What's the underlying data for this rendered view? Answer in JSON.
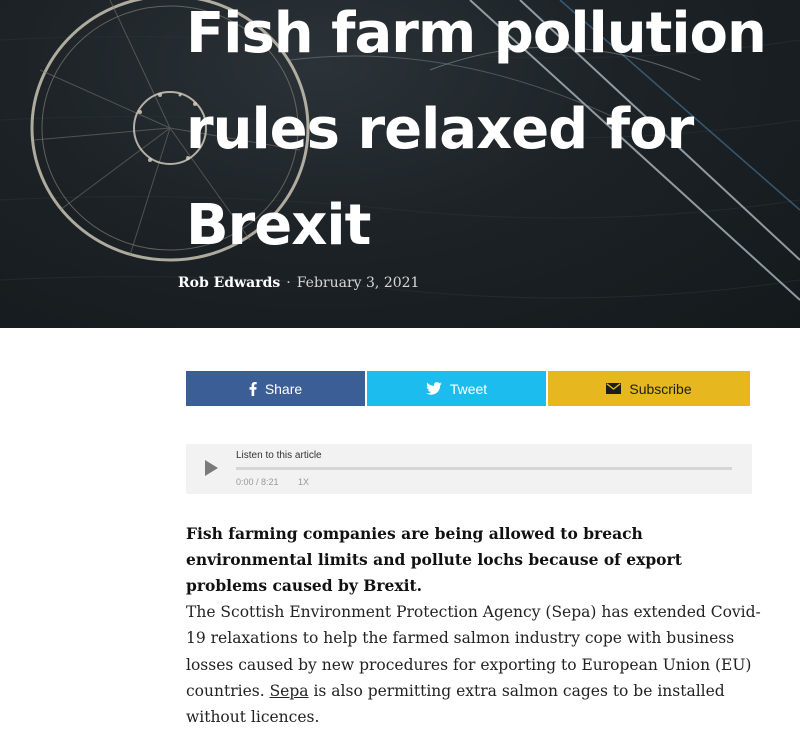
{
  "hero": {
    "title": "Fish farm pollution rules relaxed for Brexit",
    "author": "Rob Edwards",
    "separator": "·",
    "date": "February 3, 2021"
  },
  "share": {
    "facebook_label": "Share",
    "twitter_label": "Tweet",
    "subscribe_label": "Subscribe"
  },
  "audio": {
    "label": "Listen to this article",
    "time": "0:00 / 8:21",
    "speed": "1X",
    "progress": 0
  },
  "article": {
    "lead": "Fish farming companies are being allowed to breach environmental limits and pollute lochs because of export problems caused by Brexit.",
    "para1_before": "The Scottish Environment Protection Agency (Sepa) has extended Covid-19 relaxations to help the farmed salmon industry cope with business losses caused by new procedures for exporting to European Union (EU) countries. ",
    "para1_link": "Sepa",
    "para1_after": " is also permitting extra salmon cages to be installed without licences."
  }
}
